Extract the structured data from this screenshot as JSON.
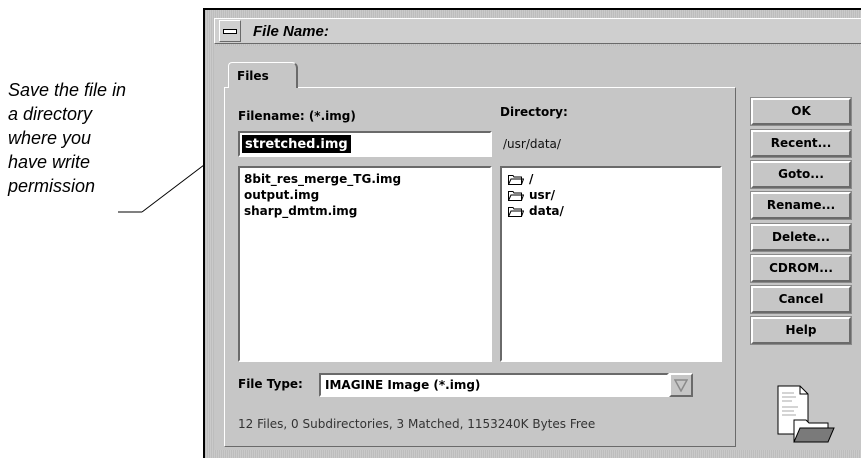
{
  "annotation": {
    "lines": [
      "Save the file in",
      "a directory",
      "where you",
      "have write",
      "permission"
    ]
  },
  "window": {
    "title": "File Name:",
    "tab_label": "Files"
  },
  "filename": {
    "label": "Filename: (*.img)",
    "value": "stretched.img"
  },
  "directory": {
    "label": "Directory:",
    "path": "/usr/data/"
  },
  "files": [
    {
      "name": "8bit_res_merge_TG.img"
    },
    {
      "name": "output.img"
    },
    {
      "name": "sharp_dmtm.img"
    }
  ],
  "dirs": [
    {
      "name": "/",
      "icon": "folder-icon"
    },
    {
      "name": "usr/",
      "icon": "folder-icon"
    },
    {
      "name": "data/",
      "icon": "folder-icon"
    }
  ],
  "file_type": {
    "label": "File Type:",
    "value": "IMAGINE Image (*.img)"
  },
  "status": "12 Files, 0 Subdirectories, 3 Matched, 1153240K Bytes Free",
  "buttons": {
    "ok": "OK",
    "recent": "Recent...",
    "goto": "Goto...",
    "rename": "Rename...",
    "delete": "Delete...",
    "cdrom": "CDROM...",
    "cancel": "Cancel",
    "help": "Help"
  },
  "colors": {
    "dialog_bg": "#c6c6c6",
    "selection_bg": "#000000",
    "selection_fg": "#ffffff"
  }
}
